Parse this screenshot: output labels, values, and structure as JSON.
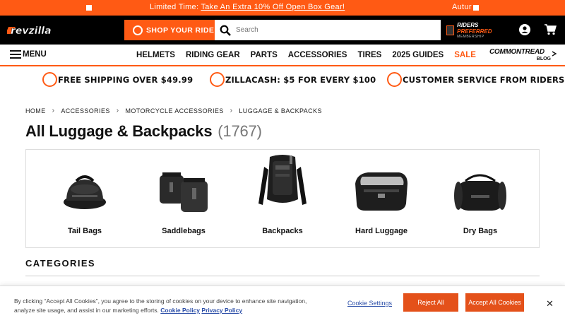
{
  "promo": {
    "lead": "Limited Time: ",
    "link": "Take An Extra 10% Off Open Box Gear!",
    "right": "Autur"
  },
  "header": {
    "logo_text": "revzilla",
    "cta": "SHOP YOUR RIDE",
    "search_placeholder": "Search",
    "riders_preferred": {
      "a": "RIDERS",
      "b": "PREFERRED",
      "c": "MEMBERSHIP"
    }
  },
  "nav": {
    "menu": "MENU",
    "links": [
      "HELMETS",
      "RIDING GEAR",
      "PARTS",
      "ACCESSORIES",
      "TIRES",
      "2025 GUIDES",
      "SALE"
    ],
    "blog": {
      "a": "COMMONTREAD",
      "b": "BLOG"
    }
  },
  "perks": [
    "FREE SHIPPING OVER $49.99",
    "ZILLACASH: $5 FOR EVERY $100",
    "CUSTOMER SERVICE FROM RIDERS"
  ],
  "breadcrumb": [
    "HOME",
    "ACCESSORIES",
    "MOTORCYCLE ACCESSORIES",
    "LUGGAGE & BACKPACKS"
  ],
  "page": {
    "title": "All Luggage & Backpacks",
    "count": "(1767)"
  },
  "categories": [
    {
      "label": "Tail Bags",
      "icon": "tail-bag-image"
    },
    {
      "label": "Saddlebags",
      "icon": "saddlebags-image"
    },
    {
      "label": "Backpacks",
      "icon": "backpack-image"
    },
    {
      "label": "Hard Luggage",
      "icon": "hard-luggage-image"
    },
    {
      "label": "Dry Bags",
      "icon": "dry-bag-image"
    }
  ],
  "sections": {
    "categories_heading": "CATEGORIES"
  },
  "cookie": {
    "text": "By clicking “Accept All Cookies”, you agree to the storing of cookies on your device to enhance site navigation, analyze site usage, and assist in our marketing efforts.",
    "policy_link": "Cookie Policy",
    "privacy_link": "Privacy Policy",
    "settings": "Cookie Settings",
    "reject": "Reject All",
    "accept": "Accept All Cookies",
    "close": "✕"
  },
  "colors": {
    "accent": "#ff5a14",
    "header_bg": "#000000",
    "link": "#2b4ea8"
  }
}
